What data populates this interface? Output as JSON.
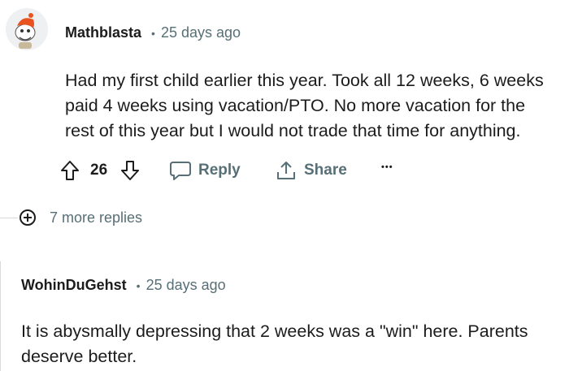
{
  "comment1": {
    "username": "Mathblasta",
    "separator": "•",
    "timestamp": "25 days ago",
    "body_lines": [
      "Had my first child earlier this year. Took all 12 weeks, 6 weeks",
      "paid 4 weeks using vacation/PTO. No more vacation for the",
      "rest of this year but I would not trade that time for anything."
    ],
    "vote_count": "26",
    "reply_label": "Reply",
    "share_label": "Share",
    "more_label": "•••",
    "avatar_icon": "snoo-avatar-icon"
  },
  "more_replies": {
    "label": "7 more replies",
    "icon": "plus-circle-icon"
  },
  "comment2": {
    "username": "WohinDuGehst",
    "separator": "•",
    "timestamp": "25 days ago",
    "body_lines": [
      "It is abysmally depressing that 2 weeks was a \"win\" here. Parents",
      "deserve better."
    ]
  },
  "colors": {
    "text": "#1c1c1c",
    "meta": "#576f76",
    "thread_line": "#d6dadc",
    "avatar_accent": "#e8531f"
  }
}
